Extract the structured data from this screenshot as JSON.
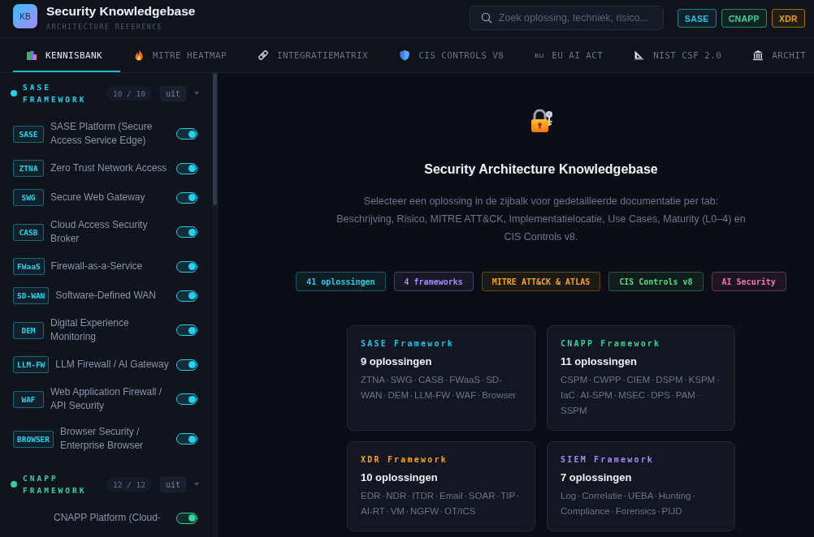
{
  "header": {
    "logo": "KB",
    "title": "Security Knowledgebase",
    "subtitle": "ARCHITECTURE REFERENCE",
    "search": {
      "placeholder": "Zoek oplossing, techniek, risico..."
    },
    "badges": [
      {
        "label": "SASE",
        "color": "#22c3e6"
      },
      {
        "label": "CNAPP",
        "color": "#34d399"
      },
      {
        "label": "XDR",
        "color": "#f59e0b"
      }
    ]
  },
  "tabs": [
    {
      "label": "KENNISBANK",
      "selected": true
    },
    {
      "label": "MITRE HEATMAP",
      "selected": false
    },
    {
      "label": "INTEGRATIEMATRIX",
      "selected": false
    },
    {
      "label": "CIS CONTROLS V8",
      "selected": false
    },
    {
      "label": "EU AI ACT",
      "selected": false,
      "icon_text": "EU"
    },
    {
      "label": "NIST CSF 2.0",
      "selected": false
    },
    {
      "label": "ARCHIT",
      "selected": false
    }
  ],
  "sidebar": {
    "groups": [
      {
        "title": "SASE FRAMEWORK",
        "color": "#22d3ee",
        "count": "10 / 10",
        "button": "uit",
        "expanded": true,
        "items": [
          {
            "tag": "SASE",
            "name": "SASE Platform (Secure Access Service Edge)",
            "on": true
          },
          {
            "tag": "ZTNA",
            "name": "Zero Trust Network Access",
            "on": true
          },
          {
            "tag": "SWG",
            "name": "Secure Web Gateway",
            "on": true
          },
          {
            "tag": "CASB",
            "name": "Cloud Access Security Broker",
            "on": true
          },
          {
            "tag": "FWaaS",
            "name": "Firewall-as-a-Service",
            "on": true
          },
          {
            "tag": "SD-WAN",
            "name": "Software-Defined WAN",
            "on": true
          },
          {
            "tag": "DEM",
            "name": "Digital Experience Monitoring",
            "on": true
          },
          {
            "tag": "LLM-FW",
            "name": "LLM Firewall / AI Gateway",
            "on": true
          },
          {
            "tag": "WAF",
            "name": "Web Application Firewall / API Security",
            "on": true
          },
          {
            "tag": "BROWSER",
            "name": "Browser Security / Enterprise Browser",
            "on": true
          }
        ]
      },
      {
        "title": "CNAPP FRAMEWORK",
        "color": "#34d399",
        "count": "12 / 12",
        "button": "uit",
        "expanded": true,
        "items": [
          {
            "name": "CNAPP Platform (Cloud-",
            "on": true
          }
        ]
      }
    ]
  },
  "main": {
    "title": "Security Architecture Knowledgebase",
    "description": "Selecteer een oplossing in de zijbalk voor gedetailleerde documentatie per tab: Beschrijving, Risico, MITRE ATT&CK, Implementatielocatie, Use Cases, Maturity (L0–4) en CIS Controls v8.",
    "pills": [
      {
        "label": "41 oplossingen",
        "color": "#38c6e0"
      },
      {
        "label": "4 frameworks",
        "color": "#a78bfa"
      },
      {
        "label": "MITRE ATT&CK & ATLAS",
        "color": "#f5a524"
      },
      {
        "label": "CIS Controls v8",
        "color": "#4ade80"
      },
      {
        "label": "AI Security",
        "color": "#f472b6"
      }
    ],
    "frameworks": [
      {
        "title": "SASE Framework",
        "color": "#22c3e6",
        "count": "9 oplossingen",
        "items": "ZTNA · SWG · CASB · FWaaS · SD-WAN · DEM · LLM-FW · WAF · Browser"
      },
      {
        "title": "CNAPP Framework",
        "color": "#34d399",
        "count": "11 oplossingen",
        "items": "CSPM · CWPP · CIEM · DSPM · KSPM · IaC · AI-SPM · MSEC · DPS · PAM · SSPM"
      },
      {
        "title": "XDR Framework",
        "color": "#f5a524",
        "count": "10 oplossingen",
        "items": "EDR · NDR · ITDR · Email · SOAR · TIP · AI-RT · VM · NGFW · OT/ICS"
      },
      {
        "title": "SIEM Framework",
        "color": "#a78bfa",
        "count": "7 oplossingen",
        "items": "Log · Correlatie · UEBA · Hunting · Compliance · Forensics · PIJD"
      }
    ]
  }
}
